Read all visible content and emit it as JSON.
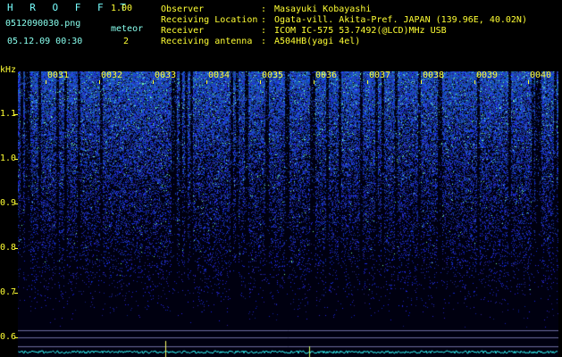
{
  "header": {
    "title": "H R O F F T",
    "version": "1.00",
    "filename": "0512090030.png",
    "datetime": "05.12.09 00:30",
    "meteor_label": "meteor",
    "meteor_count": "2",
    "info": [
      {
        "key": "Observer",
        "value": "Masayuki Kobayashi"
      },
      {
        "key": "Receiving Location",
        "value": "Ogata-vill. Akita-Pref. JAPAN (139.96E, 40.02N)"
      },
      {
        "key": "Receiver",
        "value": "ICOM IC-575 53.7492(@LCD)MHz USB"
      },
      {
        "key": "Receiving antenna",
        "value": "A504HB(yagi 4el)"
      }
    ]
  },
  "spectrogram": {
    "y_unit": "kHz",
    "y_ticks": [
      "1.1",
      "1.0",
      "0.9",
      "0.8",
      "0.7",
      "0.6"
    ],
    "x_ticks": [
      "0031",
      "0032",
      "0033",
      "0034",
      "0035",
      "0036",
      "0037",
      "0038",
      "0039",
      "0040"
    ]
  },
  "colors": {
    "axis": "#ffff33",
    "header_text": "#ffff33",
    "title": "#7ff",
    "background": "#000000"
  }
}
